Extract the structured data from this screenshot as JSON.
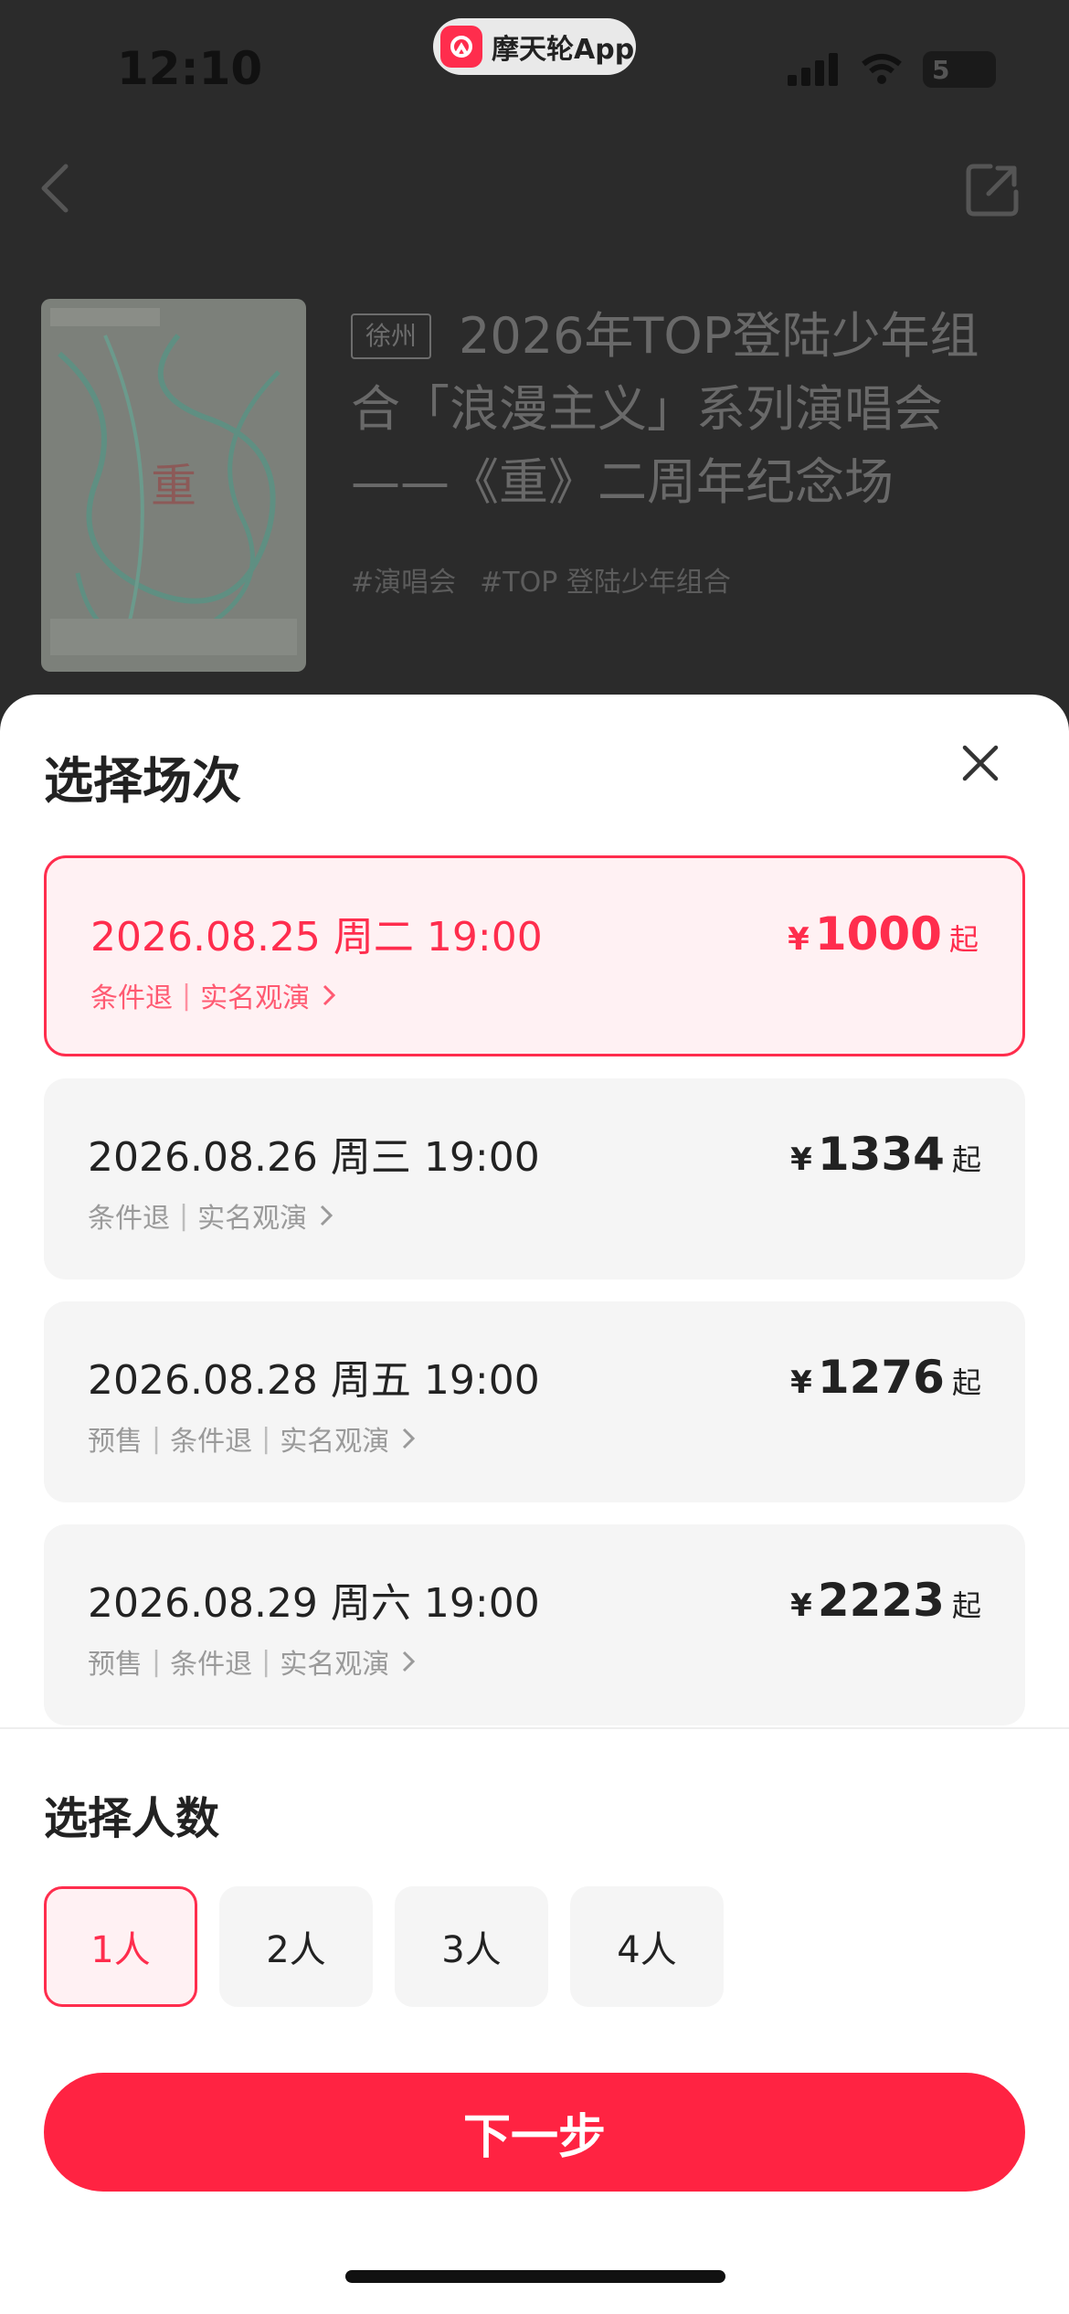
{
  "status_bar": {
    "time": "12:10",
    "app_pill": "摩天轮App",
    "battery": "5"
  },
  "event": {
    "city_tag": "徐州",
    "title": "2026年TOP登陆少年组合「浪漫主义」系列演唱会——《重》二周年纪念场",
    "tags": [
      "#演唱会",
      "#TOP 登陆少年组合"
    ],
    "poster_char": "重"
  },
  "sheet": {
    "title": "选择场次",
    "sessions": [
      {
        "date": "2026.08.25 周二 19:00",
        "meta": [
          "条件退",
          "实名观演"
        ],
        "currency": "¥",
        "price": "1000",
        "suffix": "起",
        "selected": true
      },
      {
        "date": "2026.08.26 周三 19:00",
        "meta": [
          "条件退",
          "实名观演"
        ],
        "currency": "¥",
        "price": "1334",
        "suffix": "起",
        "selected": false
      },
      {
        "date": "2026.08.28 周五 19:00",
        "meta": [
          "预售",
          "条件退",
          "实名观演"
        ],
        "currency": "¥",
        "price": "1276",
        "suffix": "起",
        "selected": false
      },
      {
        "date": "2026.08.29 周六 19:00",
        "meta": [
          "预售",
          "条件退",
          "实名观演"
        ],
        "currency": "¥",
        "price": "2223",
        "suffix": "起",
        "selected": false
      }
    ],
    "count_title": "选择人数",
    "counts": [
      "1人",
      "2人",
      "3人",
      "4人"
    ],
    "next_label": "下一步"
  },
  "colors": {
    "accent": "#ff2d4d",
    "button": "#ff2342"
  }
}
